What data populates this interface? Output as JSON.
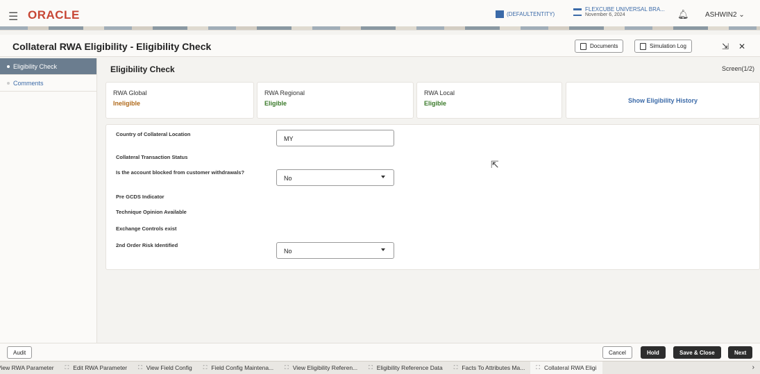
{
  "header": {
    "brand": "ORACLE",
    "entity": "(DEFAULTENTITY)",
    "branch_name": "FLEXCUBE UNIVERSAL BRA...",
    "branch_date": "November 6, 2024",
    "user": "ASHWIN2"
  },
  "titlebar": {
    "title": "Collateral RWA Eligibility - Eligibility Check",
    "documents_label": "Documents",
    "simulation_log_label": "Simulation Log"
  },
  "sidenav": {
    "items": [
      {
        "label": "Eligibility Check"
      },
      {
        "label": "Comments"
      }
    ]
  },
  "main": {
    "heading": "Eligibility Check",
    "screen_indicator": "Screen(1/2)",
    "cards": [
      {
        "label": "RWA Global",
        "value": "Ineligible"
      },
      {
        "label": "RWA Regional",
        "value": "Eligible"
      },
      {
        "label": "RWA Local",
        "value": "Eligible"
      }
    ],
    "history_label": "Show Eligibility History",
    "fields": [
      {
        "label": "Country of Collateral Location",
        "value": "MY"
      },
      {
        "label": "Collateral Transaction Status",
        "value": ""
      },
      {
        "label": "Is the account blocked from customer withdrawals?",
        "value": "No"
      },
      {
        "label": "Pre GCDS Indicator",
        "value": ""
      },
      {
        "label": "Technique Opinion Available",
        "value": ""
      },
      {
        "label": "Exchange Controls exist",
        "value": ""
      },
      {
        "label": "2nd Order Risk Identified",
        "value": "No"
      }
    ]
  },
  "footer": {
    "audit": "Audit",
    "cancel": "Cancel",
    "hold": "Hold",
    "save_close": "Save & Close",
    "next": "Next"
  },
  "taskbar": {
    "tabs": [
      "View RWA Parameter",
      "Edit RWA Parameter",
      "View Field Config",
      "Field Config Maintena...",
      "View Eligibility Referen...",
      "Eligibility Reference Data",
      "Facts To Attributes Ma...",
      "Collateral RWA Eligi"
    ]
  },
  "colors": {
    "brand": "#c74634",
    "ineligible": "#b06a1b",
    "eligible": "#3a7a2a",
    "link": "#3b6aa8",
    "nav_active": "#6b7d8f"
  }
}
